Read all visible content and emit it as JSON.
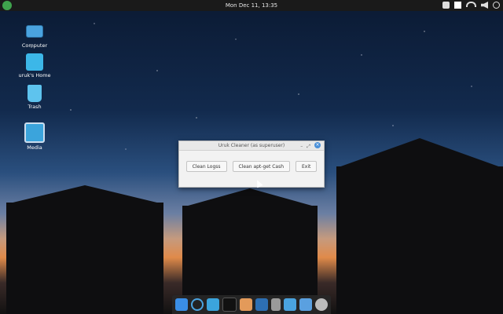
{
  "topbar": {
    "clock": "Mon Dec 11, 13:35",
    "tray_icons": [
      "lock-icon",
      "update-icon",
      "network-icon",
      "volume-icon",
      "power-icon"
    ]
  },
  "desktop": {
    "icons": [
      {
        "label": "Computer",
        "icon": "computer-icon"
      },
      {
        "label": "uruk's Home",
        "icon": "home-folder-icon"
      },
      {
        "label": "Trash",
        "icon": "trash-icon"
      },
      {
        "label": "Media",
        "icon": "media-icon"
      }
    ]
  },
  "dialog": {
    "title": "Uruk Cleaner (as superuser)",
    "buttons": {
      "clean_logs": "Clean Logss",
      "clean_cache": "Clean apt-get Cash",
      "exit": "Exit"
    },
    "controls": {
      "minimize": "–",
      "maximize": "⤢",
      "close": "×"
    }
  },
  "dock": {
    "items": [
      "downloader-icon",
      "browser-icon",
      "files-icon",
      "terminal-icon",
      "store-icon",
      "settings-gear-icon",
      "document-icon",
      "text-editor-icon",
      "display-icon",
      "system-settings-icon"
    ]
  },
  "colors": {
    "panel": "#1a1a1a",
    "accent": "#4a90d9"
  }
}
